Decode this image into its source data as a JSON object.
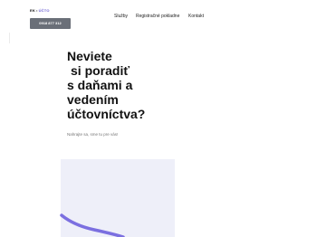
{
  "header": {
    "logo_prefix": "EK",
    "logo_sep": "•",
    "logo_brand": "ÚČTO",
    "phone_button": "0918 877 312",
    "nav": [
      "Služby",
      "Registračné pokladne",
      "Kontakt"
    ]
  },
  "hero": {
    "headline_lines": [
      "Neviete",
      "si poradiť",
      "s daňami a",
      "vedením",
      "účtovníctva?"
    ],
    "subtext": "Nahrajte sa, sme tu pre vás!"
  },
  "colors": {
    "accent": "#6b5fd3",
    "panel": "#eeeff9",
    "button": "#6a6f78"
  }
}
